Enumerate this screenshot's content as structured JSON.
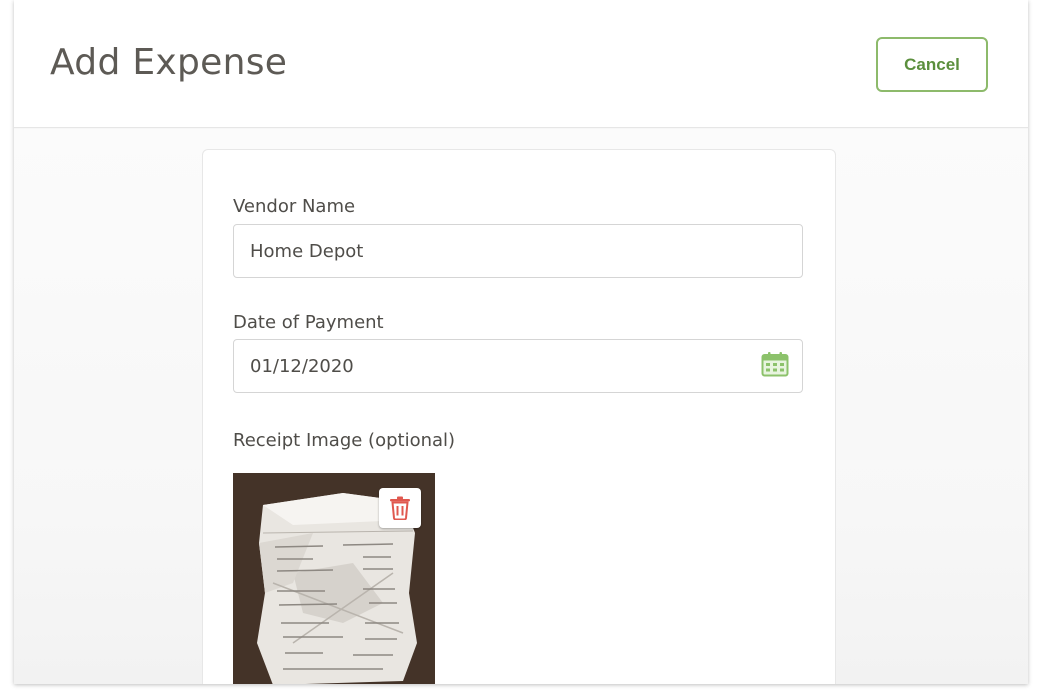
{
  "header": {
    "title": "Add Expense",
    "cancel_label": "Cancel"
  },
  "form": {
    "vendor": {
      "label": "Vendor Name",
      "value": "Home Depot"
    },
    "date": {
      "label": "Date of Payment",
      "value": "01/12/2020",
      "icon": "calendar-icon"
    },
    "receipt": {
      "label": "Receipt Image (optional)",
      "delete_icon": "trash-icon"
    }
  },
  "colors": {
    "accent_green": "#8dba6b",
    "cancel_text": "#5b8f3d",
    "delete_red": "#e0584f",
    "calendar_green": "#8cc26b"
  }
}
